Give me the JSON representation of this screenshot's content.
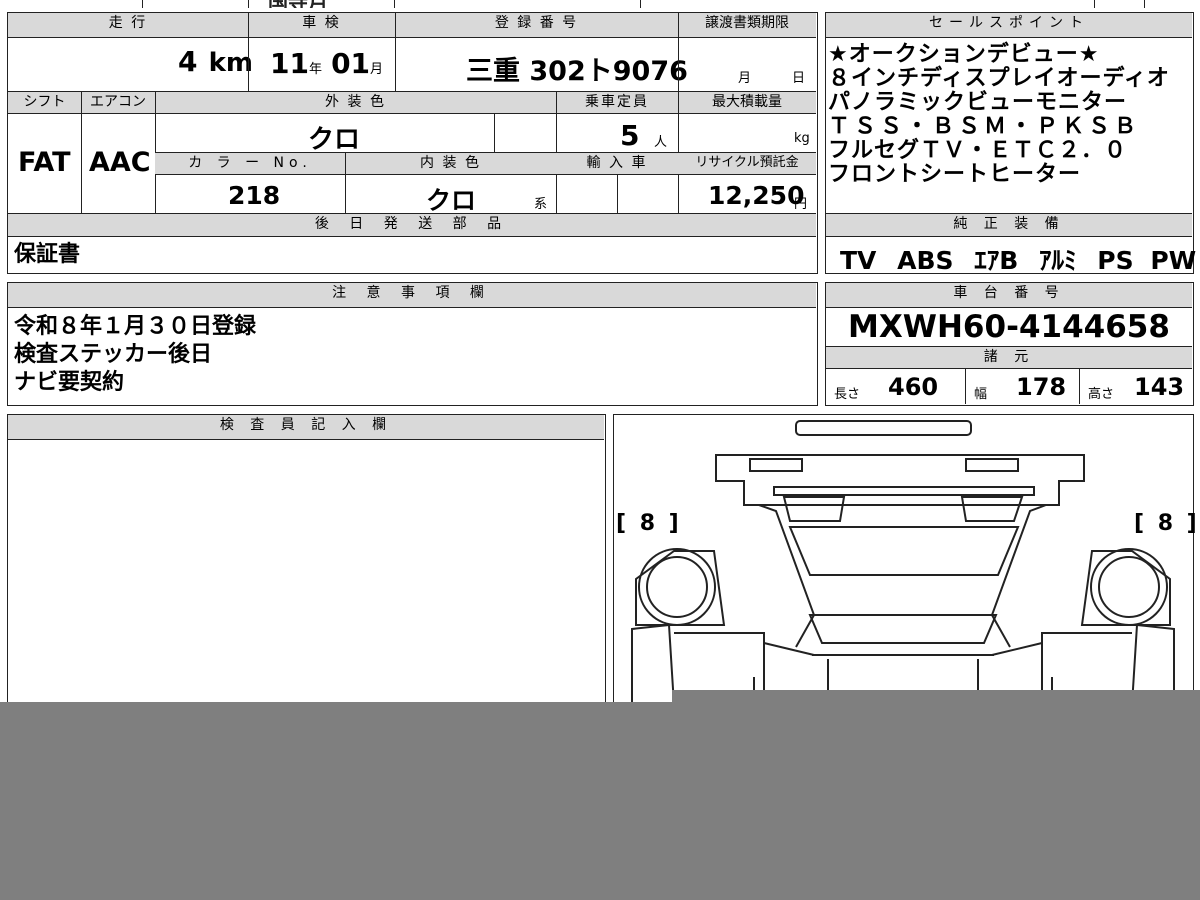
{
  "top_strip": {
    "fragment": "国寺月"
  },
  "vehicle": {
    "mileage_label": "走 行",
    "mileage_value": "4",
    "mileage_unit": "km",
    "inspection_label": "車 検",
    "inspection_year": "11",
    "inspection_year_unit": "年",
    "inspection_month": "01",
    "inspection_month_unit": "月",
    "registration_label": "登 録 番 号",
    "registration_value": "三重 302ト9076",
    "transfer_label": "譲渡書類期限",
    "transfer_month_unit": "月",
    "transfer_day_unit": "日",
    "shift_label": "シフト",
    "shift_value": "FAT",
    "aircon_label": "エアコン",
    "aircon_value": "AAC",
    "exterior_color_label": "外 装 色",
    "exterior_color_value": "クロ",
    "capacity_label": "乗車定員",
    "capacity_value": "5",
    "capacity_unit": "人",
    "max_load_label": "最大積載量",
    "max_load_unit": "kg",
    "color_no_label": "カ ラ ー No.",
    "color_no_value": "218",
    "interior_color_label": "内 装 色",
    "interior_color_value": "クロ",
    "interior_color_suffix": "系",
    "import_label": "輸 入 車",
    "recycle_label": "リサイクル預託金",
    "recycle_value": "12,250",
    "recycle_unit": "円",
    "later_parts_label": "後 日 発 送 部 品",
    "later_parts_value": "保証書"
  },
  "sales_points": {
    "label": "セールスポイント",
    "lines": [
      "★オークションデビュー★",
      "８インチディスプレイオーディオ",
      "パノラミックビューモニター",
      "ＴＳＳ・ＢＳＭ・ＰＫＳＢ",
      "フルセグＴＶ・ＥＴＣ２．０",
      "フロントシートヒーター"
    ]
  },
  "standard_equipment": {
    "label": "純 正 装 備",
    "items": [
      "TV",
      "ABS",
      "ｴｱB",
      "ｱﾙﾐ",
      "PS",
      "PW"
    ]
  },
  "notes": {
    "label": "注 意 事 項 欄",
    "lines": [
      "令和８年１月３０日登録",
      "検査ステッカー後日",
      "ナビ要契約"
    ]
  },
  "chassis": {
    "label": "車 台 番 号",
    "value": "MXWH60-4144658"
  },
  "specs": {
    "label": "諸 元",
    "length_label": "長さ",
    "length_value": "460",
    "width_label": "幅",
    "width_value": "178",
    "height_label": "高さ",
    "height_value": "143"
  },
  "inspector": {
    "label": "検 査 員 記 入 欄"
  },
  "diagram": {
    "left_marker": "[ 8 ]",
    "right_marker": "[ 8 ]"
  }
}
